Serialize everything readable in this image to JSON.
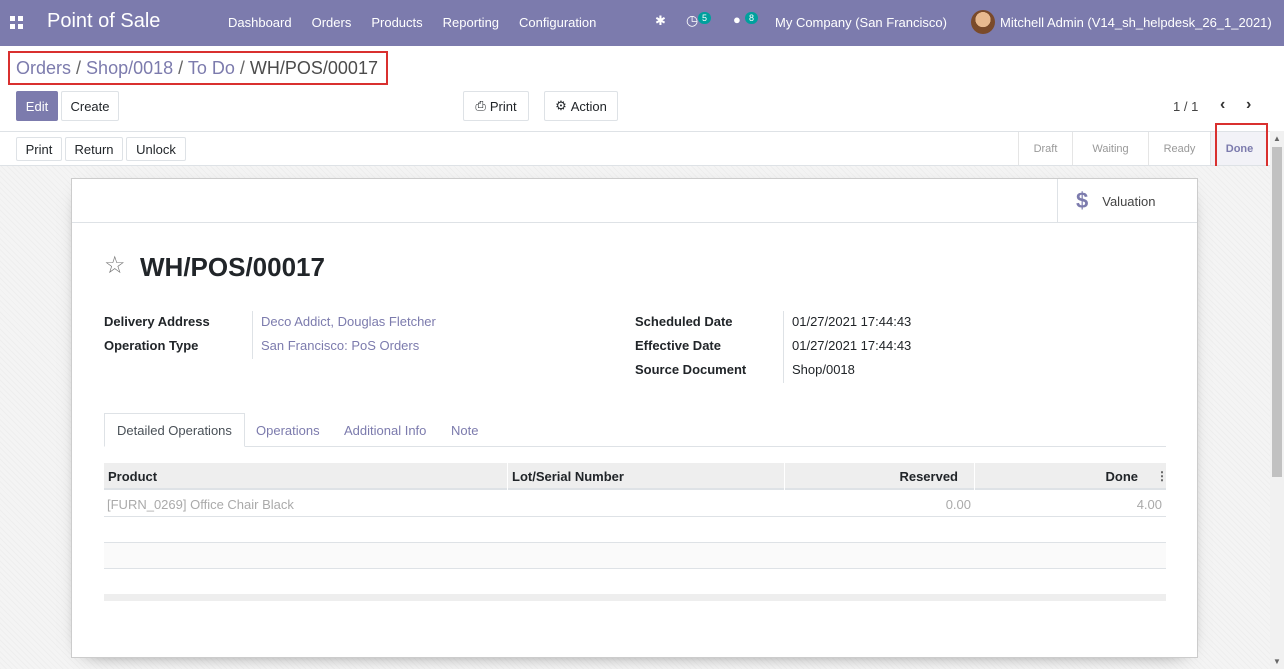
{
  "navbar": {
    "brand": "Point of Sale",
    "menu": [
      "Dashboard",
      "Orders",
      "Products",
      "Reporting",
      "Configuration"
    ],
    "activity_count": "5",
    "message_count": "8",
    "company": "My Company (San Francisco)",
    "user": "Mitchell Admin (V14_sh_helpdesk_26_1_2021)"
  },
  "breadcrumb": {
    "items": [
      "Orders",
      "Shop/0018",
      "To Do"
    ],
    "current": "WH/POS/00017",
    "separator": "/"
  },
  "toolbar": {
    "edit_label": "Edit",
    "create_label": "Create",
    "print_label": "Print",
    "action_label": "Action",
    "pager": "1 / 1"
  },
  "statusbar": {
    "buttons": [
      "Print",
      "Return",
      "Unlock"
    ],
    "stages": [
      "Draft",
      "Waiting",
      "Ready",
      "Done"
    ],
    "active_stage": "Done"
  },
  "sheet": {
    "valuation_label": "Valuation",
    "title": "WH/POS/00017",
    "fields_left": [
      {
        "label": "Delivery Address",
        "value": "Deco Addict, Douglas Fletcher"
      },
      {
        "label": "Operation Type",
        "value": "San Francisco: PoS Orders"
      }
    ],
    "fields_right": [
      {
        "label": "Scheduled Date",
        "value": "01/27/2021 17:44:43"
      },
      {
        "label": "Effective Date",
        "value": "01/27/2021 17:44:43"
      },
      {
        "label": "Source Document",
        "value": "Shop/0018"
      }
    ],
    "tabs": [
      "Detailed Operations",
      "Operations",
      "Additional Info",
      "Note"
    ],
    "table": {
      "columns": [
        "Product",
        "Lot/Serial Number",
        "Reserved",
        "Done"
      ],
      "rows": [
        {
          "product": "[FURN_0269] Office Chair Black",
          "lot": "",
          "reserved": "0.00",
          "done": "4.00"
        }
      ]
    }
  },
  "colors": {
    "brand": "#7c7bad",
    "highlight_box": "#d9302f",
    "badge": "#00a09d"
  }
}
